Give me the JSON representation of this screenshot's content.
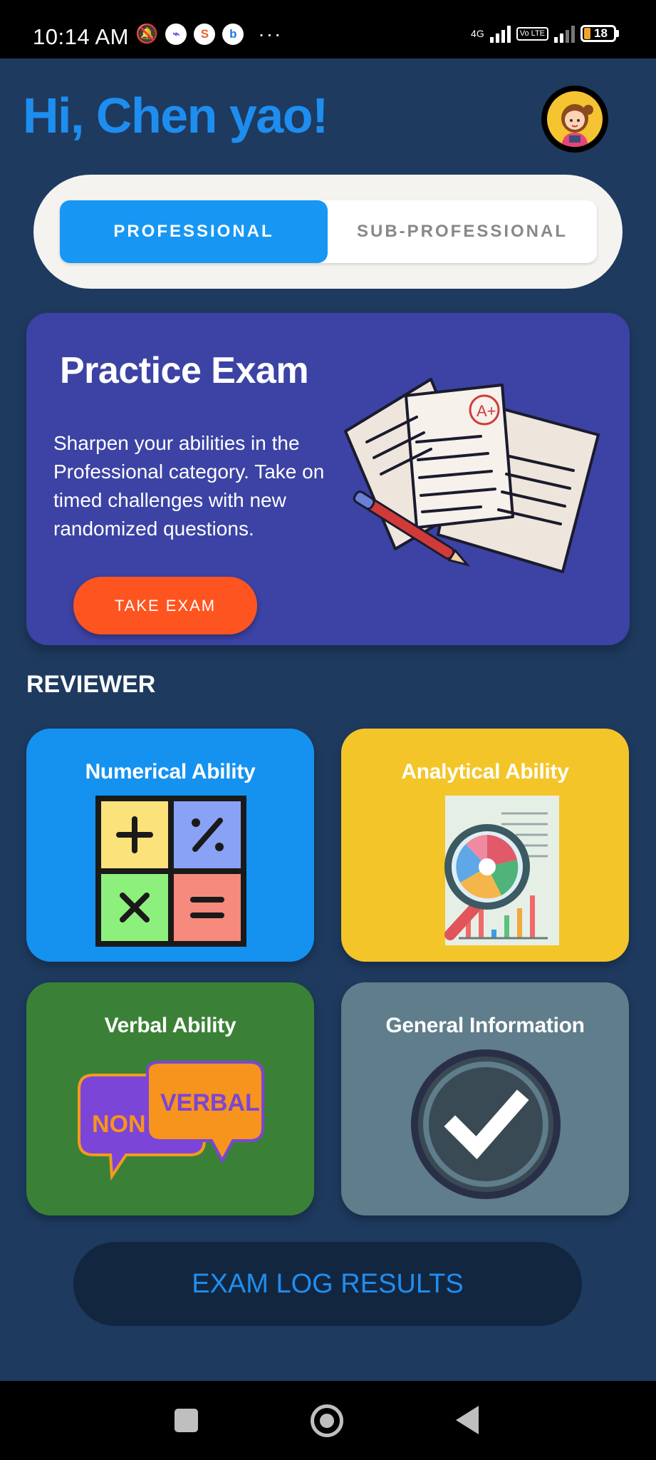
{
  "status_bar": {
    "time": "10:14 AM",
    "network": "4G",
    "volte": "Vo LTE",
    "battery": "18"
  },
  "header": {
    "greeting": "Hi, Chen yao!"
  },
  "category_toggle": {
    "options": [
      "PROFESSIONAL",
      "SUB-PROFESSIONAL"
    ],
    "selected": "PROFESSIONAL"
  },
  "practice_exam": {
    "title": "Practice Exam",
    "description": "Sharpen your abilities in the Professional category. Take on timed challenges with new randomized questions.",
    "button_label": "TAKE EXAM",
    "paper_grade": "A+"
  },
  "reviewer": {
    "section_label": "REVIEWER",
    "cards": [
      {
        "title": "Numerical Ability",
        "color": "#1592f0",
        "icon": "math-operators-icon"
      },
      {
        "title": "Analytical Ability",
        "color": "#f4c529",
        "icon": "magnifier-chart-icon"
      },
      {
        "title": "Verbal Ability",
        "color": "#3a8137",
        "icon": "speech-bubbles-icon",
        "bubble_texts": [
          "NON",
          "VERBAL"
        ]
      },
      {
        "title": "General Information",
        "color": "#5f7d8a",
        "icon": "checkmark-circle-icon"
      }
    ]
  },
  "exam_log": {
    "button_label": "EXAM LOG RESULTS"
  },
  "colors": {
    "background": "#1e3a5f",
    "accent": "#1d8ef0",
    "practice_card": "#3c43a4",
    "take_exam": "#fe5420"
  }
}
